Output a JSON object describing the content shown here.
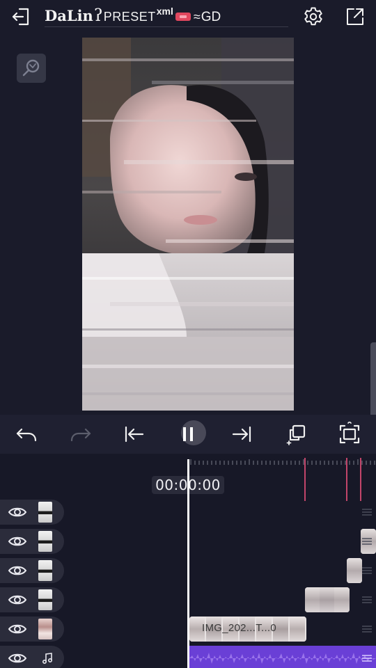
{
  "header": {
    "brand_part1": "DaLin",
    "brand_hook": "ʔ",
    "brand_part2": "PRESET",
    "brand_superscript": "xml",
    "brand_wave": "≈",
    "brand_part3": "GD",
    "icons": [
      "exit-icon",
      "settings-icon",
      "share-icon"
    ]
  },
  "preview": {
    "icons": [
      "zoom-search-icon"
    ]
  },
  "controls": {
    "icons": [
      "undo-icon",
      "redo-icon",
      "jump-to-start-icon",
      "pause-icon",
      "jump-to-end-icon",
      "crop-icon",
      "fullscreen-icon"
    ],
    "playing": true
  },
  "timeline": {
    "timecode": "00:00:00",
    "tracks": [
      {
        "type": "video",
        "visible": true,
        "thumb": "bw"
      },
      {
        "type": "video",
        "visible": true,
        "thumb": "bw"
      },
      {
        "type": "video",
        "visible": true,
        "thumb": "bw"
      },
      {
        "type": "video",
        "visible": true,
        "thumb": "bw"
      },
      {
        "type": "video",
        "visible": true,
        "thumb": "pink"
      },
      {
        "type": "audio",
        "visible": true,
        "thumb": "music-note-icon"
      }
    ],
    "main_clip_label": "IMG_202...T...0"
  },
  "colors": {
    "background": "#1a1b2a",
    "accent_marker": "#c2456a",
    "audio_clip": "#6a3fd6",
    "track_head": "#2b2c3b"
  }
}
